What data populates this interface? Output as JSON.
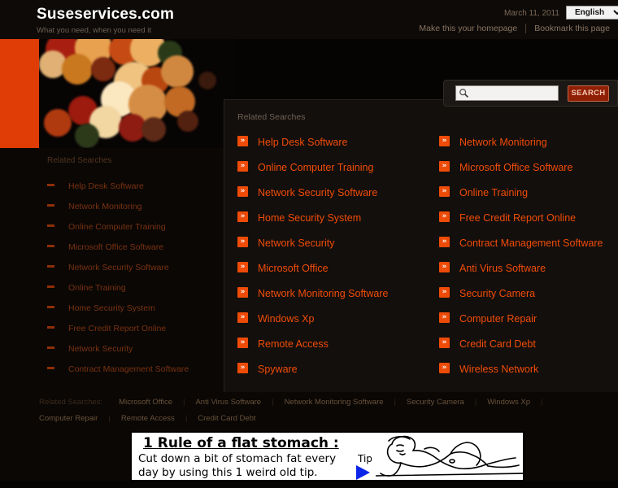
{
  "header": {
    "site_title": "Suseservices.com",
    "tagline": "What you need, when you need it",
    "date": "March 11, 2011",
    "language_selected": "English",
    "language_options": [
      "English"
    ],
    "link_homepage": "Make this your homepage",
    "link_bookmark": "Bookmark this page"
  },
  "search": {
    "value": "",
    "placeholder": "",
    "button_label": "SEARCH",
    "icon": "search-icon"
  },
  "sidebar": {
    "heading": "Related Searches",
    "items": [
      {
        "label": "Help Desk Software"
      },
      {
        "label": "Network Monitoring"
      },
      {
        "label": "Online Computer Training"
      },
      {
        "label": "Microsoft Office Software"
      },
      {
        "label": "Network Security Software"
      },
      {
        "label": "Online Training"
      },
      {
        "label": "Home Security System"
      },
      {
        "label": "Free Credit Report Online"
      },
      {
        "label": "Network Security"
      },
      {
        "label": "Contract Management Software"
      }
    ]
  },
  "overlay": {
    "heading": "Related Searches",
    "bullet_glyph": "»",
    "column_left": [
      {
        "label": "Help Desk Software"
      },
      {
        "label": "Online Computer Training"
      },
      {
        "label": "Network Security Software"
      },
      {
        "label": "Home Security System"
      },
      {
        "label": "Network Security"
      },
      {
        "label": "Microsoft Office"
      },
      {
        "label": "Network Monitoring Software"
      },
      {
        "label": "Windows Xp"
      },
      {
        "label": "Remote Access"
      },
      {
        "label": "Spyware"
      }
    ],
    "column_right": [
      {
        "label": "Network Monitoring"
      },
      {
        "label": "Microsoft Office Software"
      },
      {
        "label": "Online Training"
      },
      {
        "label": "Free Credit Report Online"
      },
      {
        "label": "Contract Management Software"
      },
      {
        "label": "Anti Virus Software"
      },
      {
        "label": "Security Camera"
      },
      {
        "label": "Computer Repair"
      },
      {
        "label": "Credit Card Debt"
      },
      {
        "label": "Wireless Network"
      }
    ]
  },
  "footer": {
    "label": "Related Searches:",
    "links": [
      "Microsoft Office",
      "Anti Virus Software",
      "Network Monitoring Software",
      "Security Camera",
      "Windows Xp",
      "Computer Repair",
      "Remote Access",
      "Credit Card Debt"
    ],
    "separator": "|"
  },
  "ad": {
    "headline": "1 Rule of a flat stomach :",
    "body": "Cut down a bit of stomach fat every day by using this 1 weird old tip.",
    "tip_label": "Tip"
  },
  "colors": {
    "accent_orange": "#f14c08",
    "hero_block": "#e03c06",
    "search_button": "#8f1f05",
    "page_background": "#0a0705",
    "overlay_background": "#130f0c",
    "ad_arrow_blue": "#0a24e8"
  }
}
